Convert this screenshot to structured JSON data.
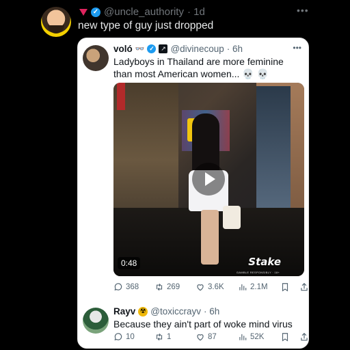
{
  "outer_post": {
    "handle": "@uncle_authority",
    "time": "· 1d",
    "text": "new type of guy just dropped"
  },
  "quoted_post": {
    "name": "voló",
    "handle": "@divinecoup",
    "time": "· 6h",
    "text": "Ladyboys in Thailand are more feminine than most American women... 💀 💀",
    "video": {
      "duration": "0:48",
      "brand": "Stake",
      "disclaimer": "GAMBLE RESPONSIBLY · 18+"
    },
    "stats": {
      "replies": "368",
      "reposts": "269",
      "likes": "3.6K",
      "views": "2.1M"
    }
  },
  "reply": {
    "name": "Rayv",
    "handle": "@toxiccrayv",
    "time": "· 6h",
    "text": "Because they ain't part of woke mind virus",
    "stats": {
      "replies": "10",
      "reposts": "1",
      "likes": "87",
      "views": "52K"
    }
  },
  "icons": {
    "more": "more-dots-icon",
    "verified": "verified-badge-icon",
    "reply": "reply-bubble-icon",
    "repost": "repost-icon",
    "like": "heart-icon",
    "views": "views-bar-icon",
    "bookmark": "bookmark-icon",
    "share": "share-icon"
  },
  "colors": {
    "background": "#000000",
    "card": "#ffffff",
    "verified": "#1d9bf0",
    "muted": "#71767b"
  }
}
